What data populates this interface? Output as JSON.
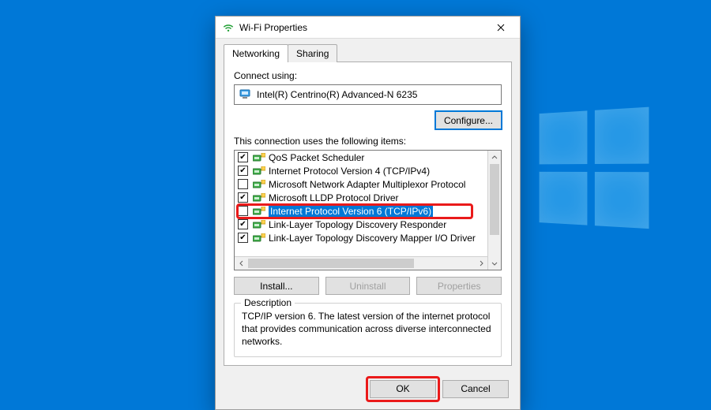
{
  "dialog": {
    "title": "Wi-Fi Properties",
    "tabs": {
      "networking": "Networking",
      "sharing": "Sharing"
    },
    "connect_using_label": "Connect using:",
    "adapter": "Intel(R) Centrino(R) Advanced-N 6235",
    "configure_btn": "Configure...",
    "list_label": "This connection uses the following items:",
    "items": [
      {
        "label": "QoS Packet Scheduler",
        "checked": true,
        "selected": false
      },
      {
        "label": "Internet Protocol Version 4 (TCP/IPv4)",
        "checked": true,
        "selected": false
      },
      {
        "label": "Microsoft Network Adapter Multiplexor Protocol",
        "checked": false,
        "selected": false
      },
      {
        "label": "Microsoft LLDP Protocol Driver",
        "checked": true,
        "selected": false
      },
      {
        "label": "Internet Protocol Version 6 (TCP/IPv6)",
        "checked": false,
        "selected": true
      },
      {
        "label": "Link-Layer Topology Discovery Responder",
        "checked": true,
        "selected": false
      },
      {
        "label": "Link-Layer Topology Discovery Mapper I/O Driver",
        "checked": true,
        "selected": false
      }
    ],
    "install_btn": "Install...",
    "uninstall_btn": "Uninstall",
    "properties_btn": "Properties",
    "desc_legend": "Description",
    "desc_text": "TCP/IP version 6. The latest version of the internet protocol that provides communication across diverse interconnected networks.",
    "ok_btn": "OK",
    "cancel_btn": "Cancel"
  }
}
